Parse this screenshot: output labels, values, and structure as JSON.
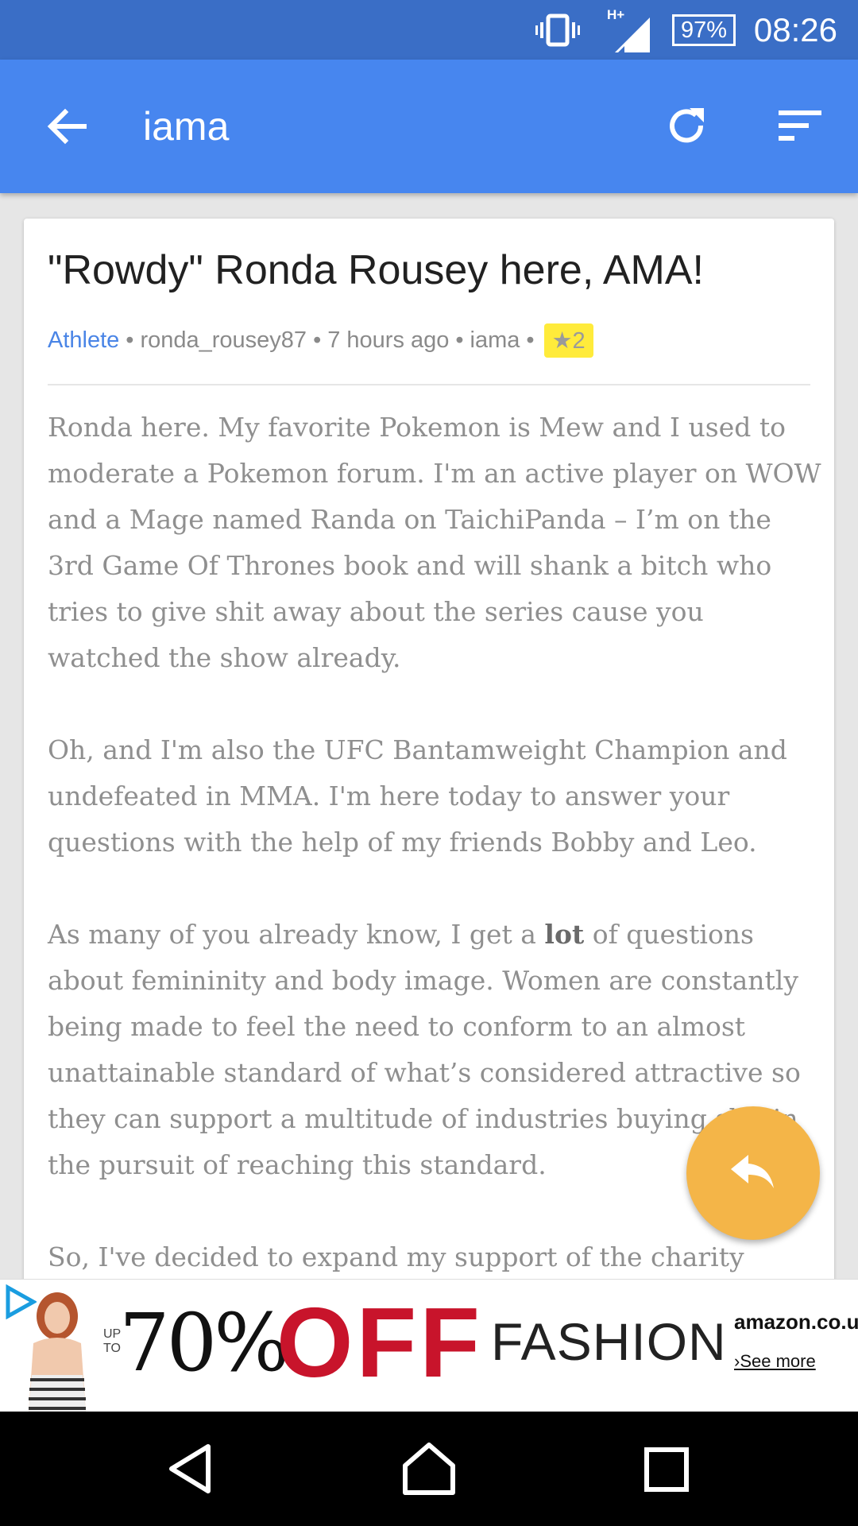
{
  "status_bar": {
    "network": "H+",
    "battery": "97%",
    "time": "08:26"
  },
  "app_bar": {
    "title": "iama",
    "icons": [
      "back-arrow-icon",
      "refresh-icon",
      "sort-icon"
    ]
  },
  "post": {
    "title": "\"Rowdy\" Ronda Rousey here, AMA!",
    "flair": "Athlete",
    "author": "ronda_rousey87",
    "time_ago": "7 hours ago",
    "subreddit": "iama",
    "score": "★2",
    "body": {
      "p1": "Ronda here. My favorite Pokemon is Mew and I used to moderate a Pokemon forum. I'm an active player on WOW and a Mage named Randa on TaichiPanda – I’m on the 3rd Game Of Thrones book and will shank a bitch who tries to give shit away about the series cause you watched the show already.",
      "p2": "Oh, and I'm also the UFC Bantamweight Champion and undefeated in MMA. I'm here today to answer your questions with the help of my friends Bobby and Leo.",
      "p3_before": "As many of you already know, I get a ",
      "p3_bold": "lot",
      "p3_after": " of questions about femininity and body image. Women are constantly being made to feel the need to conform to an almost unattainable standard of what’s considered attractive so they can support a multitude of industries buying shit in the pursuit of reaching this standard.",
      "p4": "So, I've decided to expand my support of the charity"
    }
  },
  "fab": {
    "icon": "reply-icon"
  },
  "ad": {
    "upto": "UP TO",
    "percent": "70%",
    "off": "OFF",
    "category": "FASHION",
    "brand": "amazon.co.uk",
    "cta": "›See more",
    "colors": {
      "off": "#c8142b"
    }
  },
  "nav_bar": {
    "buttons": [
      "back-triangle-icon",
      "home-icon",
      "recents-icon"
    ]
  },
  "colors": {
    "status_bar": "#3a6ec6",
    "app_bar": "#4786ef",
    "flair": "#4a85e6",
    "badge": "#ffeb3b",
    "fab": "#f4b548"
  }
}
